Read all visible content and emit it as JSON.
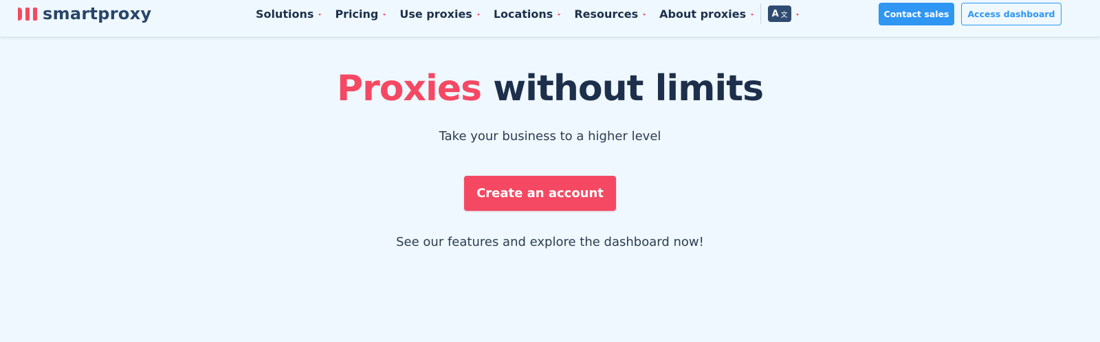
{
  "header": {
    "logo_text": "smartproxy",
    "nav": [
      {
        "label": "Solutions"
      },
      {
        "label": "Pricing"
      },
      {
        "label": "Use proxies"
      },
      {
        "label": "Locations"
      },
      {
        "label": "Resources"
      },
      {
        "label": "About proxies"
      }
    ],
    "language_icon": {
      "primary": "A",
      "secondary": "文"
    },
    "contact_sales_label": "Contact sales",
    "access_dashboard_label": "Access dashboard"
  },
  "hero": {
    "headline_accent": "Proxies",
    "headline_rest": " without limits",
    "subtitle": "Take your business to a higher level",
    "cta_label": "Create an account",
    "footnote": "See our features and explore the dashboard now!"
  },
  "colors": {
    "background": "#eef8fe",
    "accent": "#f54963",
    "primary_blue": "#2f96f3",
    "text_dark": "#1d2f4a"
  },
  "icons": [
    "logo-mark-icon",
    "caret-down-icon",
    "translate-icon"
  ]
}
